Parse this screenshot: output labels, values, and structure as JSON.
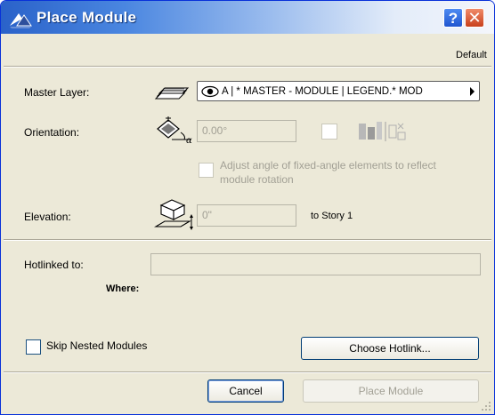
{
  "window": {
    "title": "Place Module",
    "help_label": "?",
    "close_label": "✕"
  },
  "header": {
    "preset": "Default"
  },
  "master_layer": {
    "label": "Master Layer:",
    "value": "A | * MASTER - MODULE | LEGEND.* MOD"
  },
  "orientation": {
    "label": "Orientation:",
    "value": "0.00°",
    "adjust_text_line1": "Adjust angle of fixed-angle elements to reflect",
    "adjust_text_line2": "module rotation",
    "adjust_checked": false
  },
  "elevation": {
    "label": "Elevation:",
    "value": "0\"",
    "reference": "to Story 1"
  },
  "hotlink": {
    "label": "Hotlinked to:",
    "value": "",
    "where_label": "Where:"
  },
  "options": {
    "skip_nested_label": "Skip Nested Modules",
    "skip_nested_checked": false,
    "choose_hotlink_label": "Choose Hotlink..."
  },
  "footer": {
    "cancel_label": "Cancel",
    "place_label": "Place Module"
  },
  "colors": {
    "dialog_bg": "#ece9d8",
    "titlebar_blue": "#2a62c9",
    "disabled_text": "#a2a095"
  }
}
